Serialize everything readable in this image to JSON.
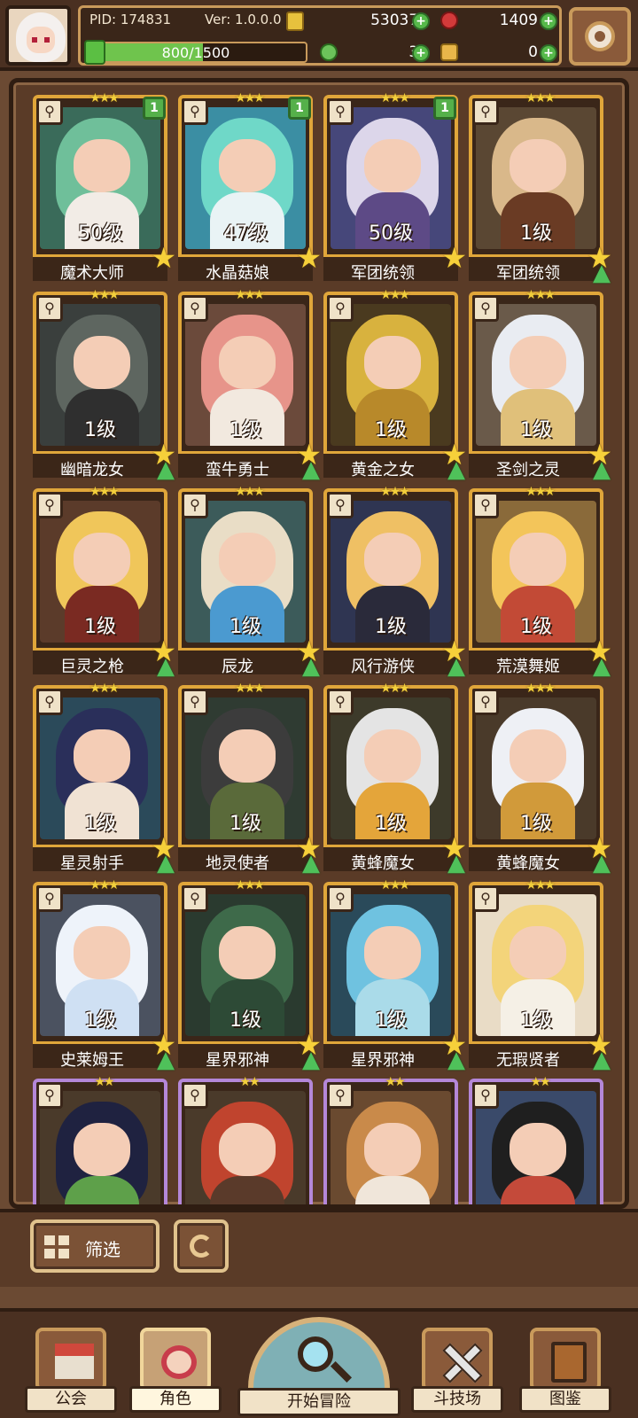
{
  "header": {
    "pid": "PID: 174831",
    "version": "Ver: 1.0.0.0",
    "gold": "530371",
    "ruby": "1409",
    "xp_text": "800/1500",
    "xp_fraction": 0.5333,
    "clover": "38",
    "key": "0"
  },
  "cards": [
    {
      "name": "魔术大师",
      "level": "50级",
      "stars": "★★★",
      "badge": "1",
      "weapon": "⚲",
      "frame": "gold",
      "bg": "#3a6b5a",
      "hair": "#6fbf9a",
      "body": "#f2ece6",
      "arrow": false
    },
    {
      "name": "水晶菇娘",
      "level": "47级",
      "stars": "★★★",
      "badge": "1",
      "weapon": "⚲",
      "frame": "gold",
      "bg": "#3b8ea3",
      "hair": "#6fd8c8",
      "body": "#e9f3f5",
      "arrow": false
    },
    {
      "name": "军团统领",
      "level": "50级",
      "stars": "★★★",
      "badge": "1",
      "weapon": "⚲",
      "frame": "gold",
      "bg": "#46477a",
      "hair": "#dcd6ea",
      "body": "#5d4a86",
      "arrow": false
    },
    {
      "name": "军团统领",
      "level": "1级",
      "stars": "★★★",
      "badge": "",
      "weapon": "⚲",
      "frame": "gold",
      "bg": "#5a4733",
      "hair": "#d9b88a",
      "body": "#6a3b24",
      "arrow": true
    },
    {
      "name": "幽暗龙女",
      "level": "1级",
      "stars": "★★★",
      "badge": "",
      "weapon": "⚲",
      "frame": "gold",
      "bg": "#3a3f3d",
      "hair": "#5e6660",
      "body": "#2f2f2f",
      "arrow": true
    },
    {
      "name": "蛮牛勇士",
      "level": "1级",
      "stars": "★★★",
      "badge": "",
      "weapon": "⚲",
      "frame": "gold",
      "bg": "#6b4a3b",
      "hair": "#e7948a",
      "body": "#f2e9df",
      "arrow": true
    },
    {
      "name": "黄金之女",
      "level": "1级",
      "stars": "★★★",
      "badge": "",
      "weapon": "⚲",
      "frame": "gold",
      "bg": "#4a3a1f",
      "hair": "#d8b23e",
      "body": "#b8892a",
      "arrow": true
    },
    {
      "name": "圣剑之灵",
      "level": "1级",
      "stars": "★★★",
      "badge": "",
      "weapon": "⚲",
      "frame": "gold",
      "bg": "#6a5a4a",
      "hair": "#e9ecf2",
      "body": "#e0c07a",
      "arrow": true
    },
    {
      "name": "巨灵之枪",
      "level": "1级",
      "stars": "★★★",
      "badge": "",
      "weapon": "⚲",
      "frame": "gold",
      "bg": "#5b3b2a",
      "hair": "#f0c65a",
      "body": "#7a2a22",
      "arrow": true
    },
    {
      "name": "辰龙",
      "level": "1级",
      "stars": "★★★",
      "badge": "",
      "weapon": "⚲",
      "frame": "gold",
      "bg": "#3c5b5a",
      "hair": "#e9ddc6",
      "body": "#4b9ad0",
      "arrow": true
    },
    {
      "name": "风行游侠",
      "level": "1级",
      "stars": "★★★",
      "badge": "",
      "weapon": "⚲",
      "frame": "gold",
      "bg": "#2f3552",
      "hair": "#efc064",
      "body": "#2a2a3a",
      "arrow": true
    },
    {
      "name": "荒漠舞姬",
      "level": "1级",
      "stars": "★★★",
      "badge": "",
      "weapon": "⚲",
      "frame": "gold",
      "bg": "#8a6a3a",
      "hair": "#f3c55a",
      "body": "#c24a36",
      "arrow": true
    },
    {
      "name": "星灵射手",
      "level": "1级",
      "stars": "★★★",
      "badge": "",
      "weapon": "⚲",
      "frame": "gold",
      "bg": "#2b4a5a",
      "hair": "#2a2f5a",
      "body": "#f0e2d3",
      "arrow": true
    },
    {
      "name": "地灵使者",
      "level": "1级",
      "stars": "★★★",
      "badge": "",
      "weapon": "⚲",
      "frame": "gold",
      "bg": "#2f3b32",
      "hair": "#3c3c3c",
      "body": "#5a6a3a",
      "arrow": true
    },
    {
      "name": "黄蜂魔女",
      "level": "1级",
      "stars": "★★★",
      "badge": "",
      "weapon": "⚲",
      "frame": "gold",
      "bg": "#3d3a2a",
      "hair": "#e4e4e4",
      "body": "#e4a53a",
      "arrow": true
    },
    {
      "name": "黄蜂魔女",
      "level": "1级",
      "stars": "★★★",
      "badge": "",
      "weapon": "⚲",
      "frame": "gold",
      "bg": "#4a3a2a",
      "hair": "#eef0f5",
      "body": "#d19a3a",
      "arrow": true
    },
    {
      "name": "史莱姆王",
      "level": "1级",
      "stars": "★★★",
      "badge": "",
      "weapon": "⚲",
      "frame": "gold",
      "bg": "#4b5260",
      "hair": "#eef3fa",
      "body": "#cfe0f3",
      "arrow": true
    },
    {
      "name": "星界邪神",
      "level": "1级",
      "stars": "★★★",
      "badge": "",
      "weapon": "⚲",
      "frame": "gold",
      "bg": "#2a3a2f",
      "hair": "#3e6a4a",
      "body": "#2d4a36",
      "arrow": true
    },
    {
      "name": "星界邪神",
      "level": "1级",
      "stars": "★★★",
      "badge": "",
      "weapon": "⚲",
      "frame": "gold",
      "bg": "#2a4a5a",
      "hair": "#6fc2e0",
      "body": "#aadbe9",
      "arrow": true
    },
    {
      "name": "无瑕贤者",
      "level": "1级",
      "stars": "★★★",
      "badge": "",
      "weapon": "⚲",
      "frame": "gold",
      "bg": "#e9dcc6",
      "hair": "#f3d47a",
      "body": "#f5f0e6",
      "arrow": true
    },
    {
      "name": "",
      "level": "",
      "stars": "★★",
      "badge": "",
      "weapon": "⚲",
      "frame": "purple",
      "bg": "#4a3a2a",
      "hair": "#1f2240",
      "body": "#5ea04a",
      "arrow": false
    },
    {
      "name": "",
      "level": "",
      "stars": "★★",
      "badge": "",
      "weapon": "⚲",
      "frame": "purple",
      "bg": "#4a3a2a",
      "hair": "#c0442e",
      "body": "#5a3a2a",
      "arrow": false
    },
    {
      "name": "",
      "level": "",
      "stars": "★★",
      "badge": "",
      "weapon": "⚲",
      "frame": "purple",
      "bg": "#6a4a30",
      "hair": "#c98a4a",
      "body": "#f0e6da",
      "arrow": false
    },
    {
      "name": "",
      "level": "",
      "stars": "★★",
      "badge": "",
      "weapon": "⚲",
      "frame": "purple",
      "bg": "#3a4a6a",
      "hair": "#1f1f1f",
      "body": "#c44a3a",
      "arrow": false
    }
  ],
  "filter": {
    "filter_label": "筛选"
  },
  "nav": {
    "guild": "公会",
    "characters": "角色",
    "adventure": "开始冒险",
    "arena": "斗技场",
    "codex": "图鉴"
  }
}
